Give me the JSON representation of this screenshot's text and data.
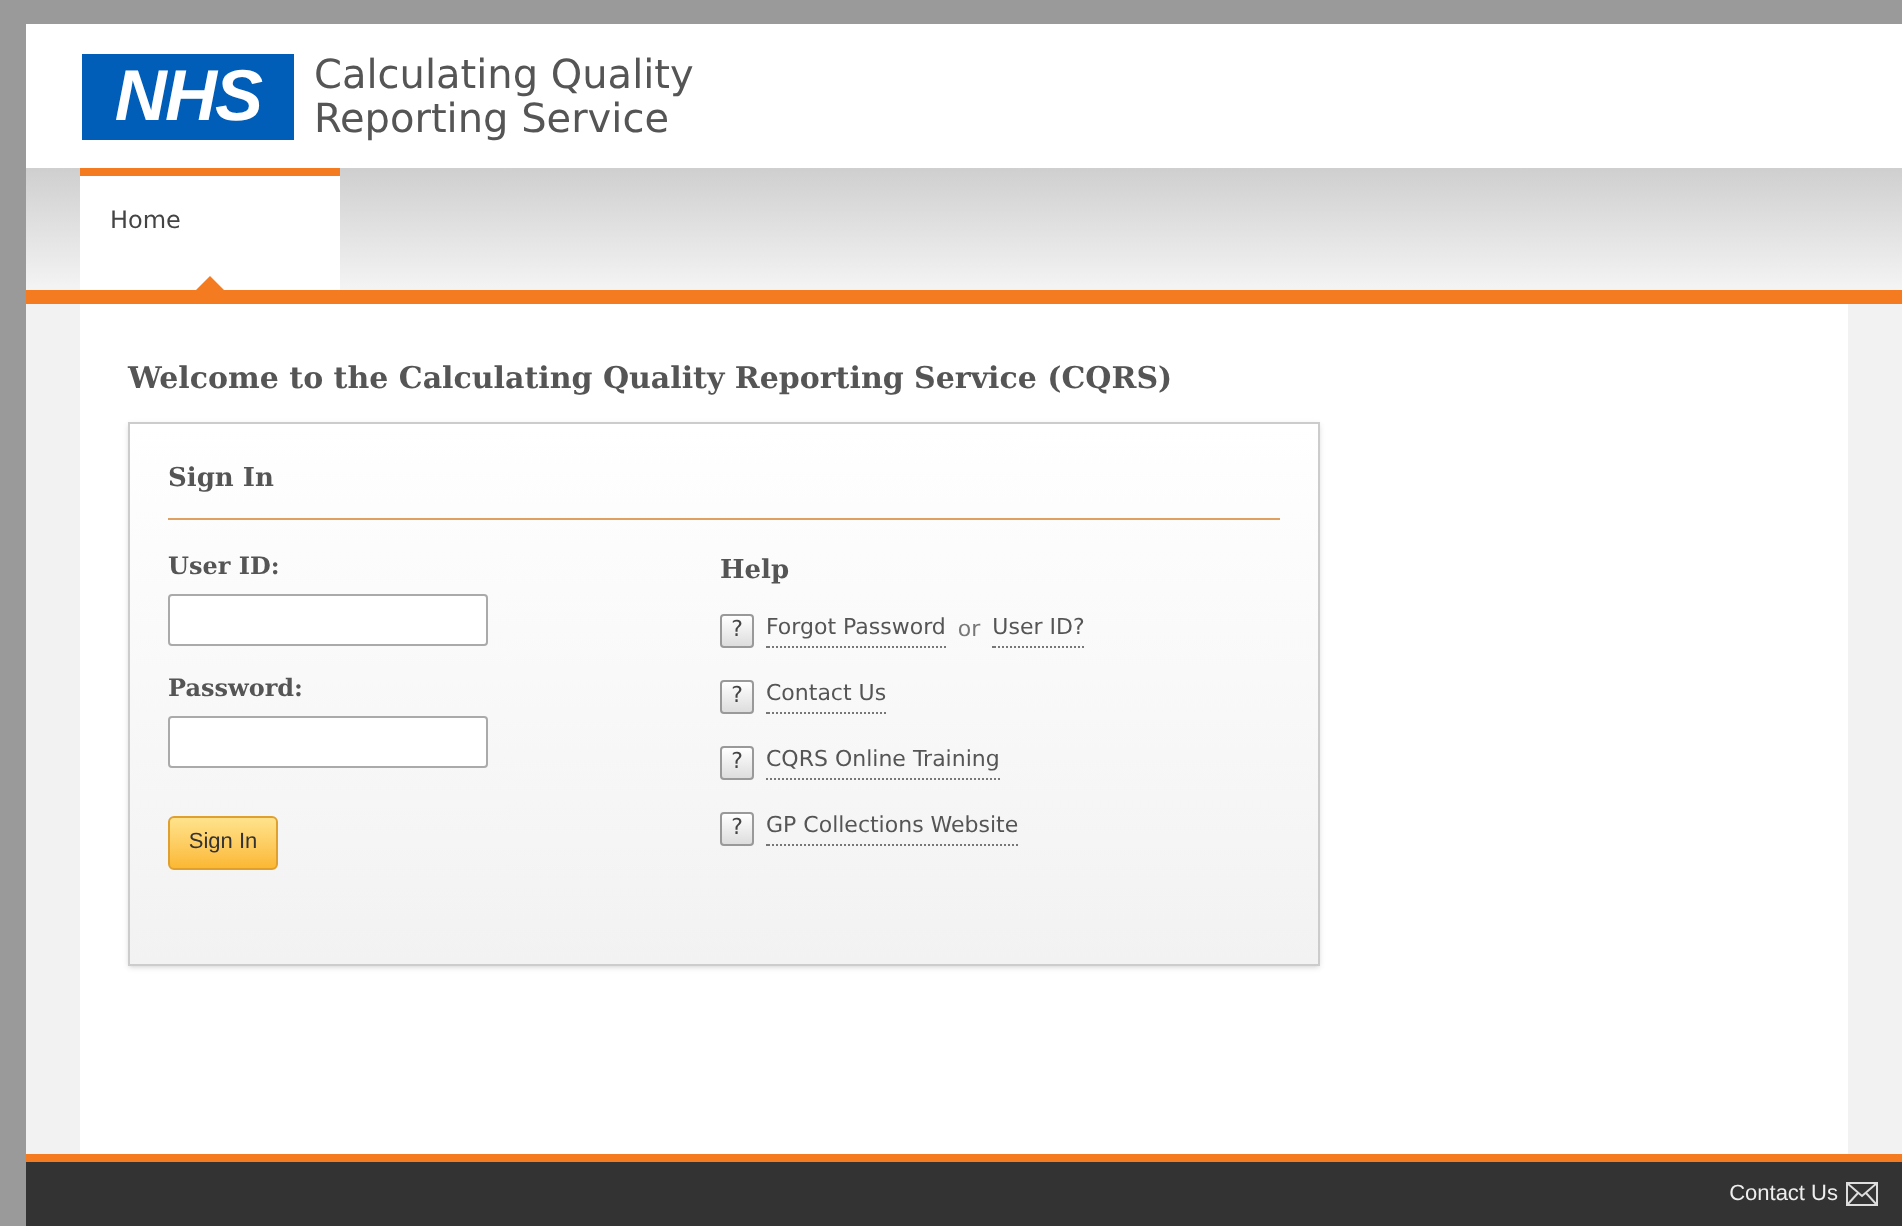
{
  "header": {
    "logo": "NHS",
    "title_line_1": "Calculating Quality",
    "title_line_2": "Reporting Service"
  },
  "nav": {
    "tabs": [
      {
        "label": "Home",
        "selected": true
      }
    ]
  },
  "welcome": "Welcome to the Calculating Quality Reporting Service (CQRS)",
  "sign_in": {
    "title": "Sign In",
    "fields": [
      {
        "label": "User ID:"
      },
      {
        "label": "Password:"
      }
    ],
    "button": "Sign In"
  },
  "help": {
    "title": "Help",
    "items": [
      {
        "icon": "?",
        "link": "Forgot Password",
        "connector": "or",
        "link_2": "User ID?"
      },
      {
        "icon": "?",
        "link": "Contact Us"
      },
      {
        "icon": "?",
        "link": "CQRS Online Training"
      },
      {
        "icon": "?",
        "link": "GP Collections Website"
      }
    ]
  },
  "footer": {
    "contact": "Contact Us"
  }
}
